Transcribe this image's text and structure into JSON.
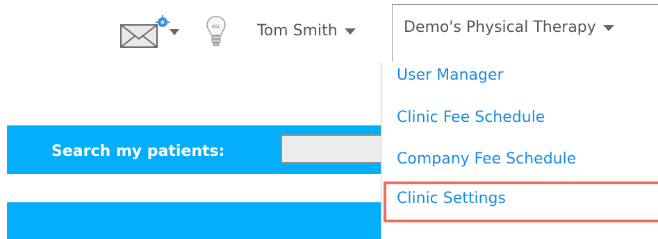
{
  "header": {
    "mail_icon": "envelope-with-notification-icon",
    "idea_icon": "lightbulb-icon",
    "user_name": "Tom Smith",
    "clinic_name": "Demo's Physical Therapy"
  },
  "search": {
    "label": "Search my patients:",
    "value": ""
  },
  "dropdown": {
    "items": [
      {
        "label": "User Manager"
      },
      {
        "label": "Clinic Fee Schedule"
      },
      {
        "label": "Company Fee Schedule"
      },
      {
        "label": "Clinic Settings",
        "highlighted": true
      }
    ]
  },
  "colors": {
    "accent_blue": "#05aefb",
    "link_blue": "#1a8be0",
    "highlight": "#f26b5b"
  }
}
